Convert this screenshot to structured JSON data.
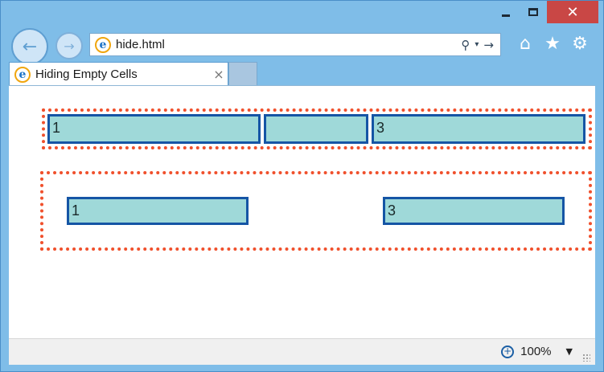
{
  "window": {
    "minimize_icon": "minimize-icon",
    "maximize_icon": "maximize-icon",
    "close_glyph": "✕"
  },
  "toolbar": {
    "back_glyph": "←",
    "forward_glyph": "→",
    "search_glyph": "⚲",
    "dropdown_glyph": "▾",
    "go_glyph": "→",
    "home_glyph": "⌂",
    "favorites_glyph": "★",
    "tools_glyph": "⚙"
  },
  "address": {
    "url": "hide.html",
    "site_icon_letter": "e"
  },
  "tabs": [
    {
      "label": "Hiding Empty Cells",
      "close_glyph": "×",
      "icon_letter": "e"
    }
  ],
  "page": {
    "table1": {
      "cells": [
        "1",
        "",
        "3"
      ]
    },
    "table2": {
      "cells": [
        "1",
        "3"
      ]
    }
  },
  "status": {
    "zoom": "100%",
    "zoom_glyph": "+",
    "zoom_dropdown": "▼"
  },
  "colors": {
    "chrome": "#7fbde8",
    "close_button": "#c94745",
    "table_border_dotted": "#f0502c",
    "cell_background": "#9fd9d9",
    "cell_border": "#1555a5"
  }
}
